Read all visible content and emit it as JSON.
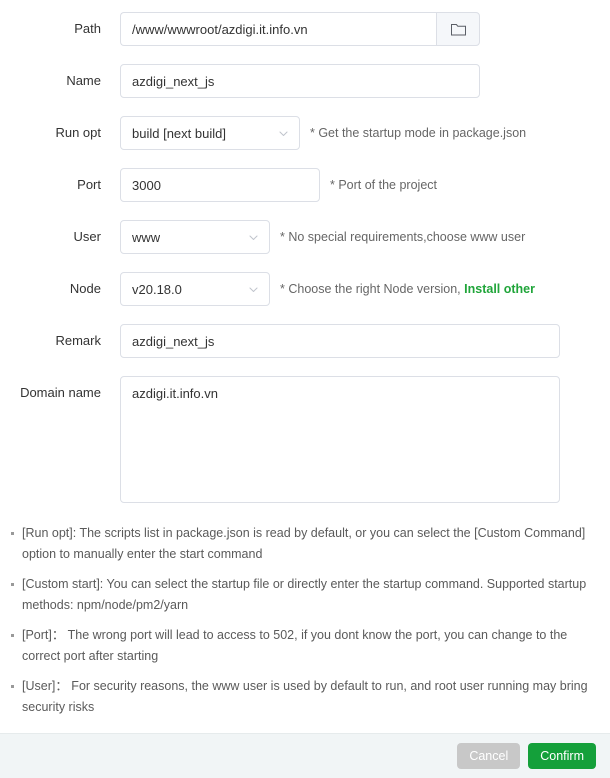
{
  "form": {
    "fields": [
      {
        "label": "Path",
        "value": "/www/wwwroot/azdigi.it.info.vn",
        "placeholder": ""
      },
      {
        "label": "Name",
        "value": "azdigi_next_js",
        "placeholder": ""
      },
      {
        "label": "Run opt",
        "value": "build [next build]",
        "hint_prefix": "* Get the startup mode in package.json",
        "hint_link": ""
      },
      {
        "label": "Port",
        "value": "3000",
        "hint_prefix": "* Port of the project",
        "hint_link": ""
      },
      {
        "label": "User",
        "value": "www",
        "hint_prefix": "* No special requirements,choose www user",
        "hint_link": ""
      },
      {
        "label": "Node",
        "value": "v20.18.0",
        "hint_prefix": "* Choose the right Node version, ",
        "hint_link": "Install other"
      },
      {
        "label": "Remark",
        "value": "azdigi_next_js",
        "placeholder": ""
      },
      {
        "label": "Domain name",
        "value": "azdigi.it.info.vn",
        "placeholder": ""
      }
    ],
    "browse_icon": "folder-icon",
    "dropdown_icon": "chevron-down-icon"
  },
  "help": {
    "items": [
      "[Run opt]: The scripts list in package.json is read by default, or you can select the [Custom Command] option to manually enter the start command",
      "[Custom start]: You can select the startup file or directly enter the startup command. Supported startup methods: npm/node/pm2/yarn",
      "[Port]： The wrong port will lead to access to 502, if you dont know the port, you can change to the correct port after starting",
      "[User]： For security reasons, the www user is used by default to run, and root user running may bring security risks"
    ]
  },
  "footer": {
    "cancel_label": "Cancel",
    "confirm_label": "Confirm"
  },
  "colors": {
    "accent_green": "#14a03a",
    "link_green": "#20a53a",
    "cancel_gray": "#c8c8c8",
    "border": "#dcdfe6",
    "footer_bg": "#f1f5f6"
  }
}
